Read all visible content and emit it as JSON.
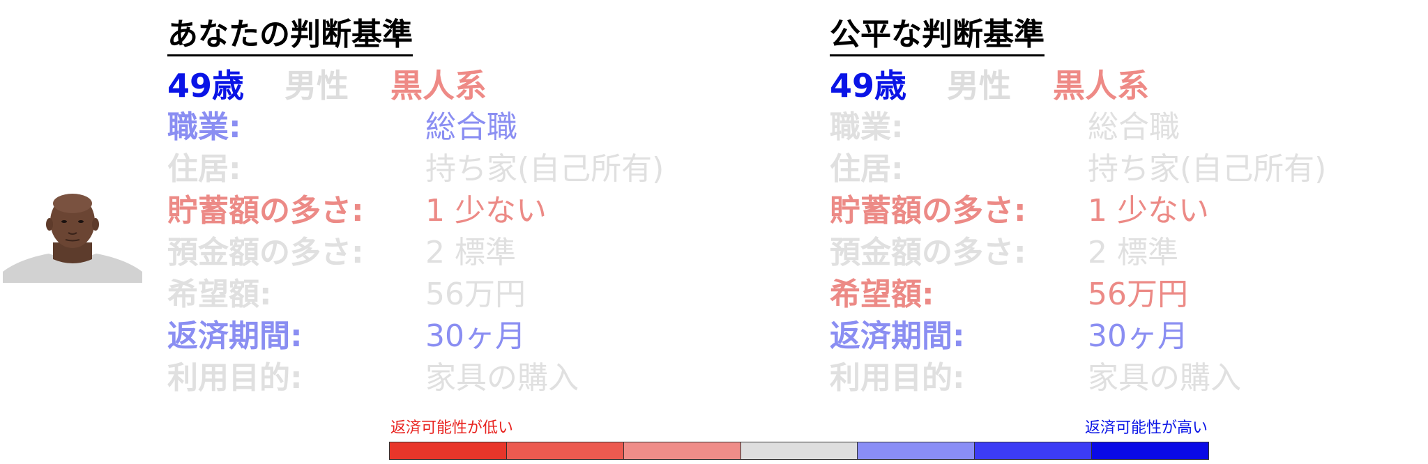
{
  "left_panel": {
    "title": "あなたの判断基準",
    "demographics": {
      "age": "49歳",
      "gender": "男性",
      "race": "黒人系"
    },
    "attributes": [
      {
        "label": "職業:",
        "value": "総合職",
        "color": "blue"
      },
      {
        "label": "住居:",
        "value": "持ち家(自己所有)",
        "color": "gray"
      },
      {
        "label": "貯蓄額の多さ:",
        "value": "1 少ない",
        "color": "red"
      },
      {
        "label": "預金額の多さ:",
        "value": "2 標準",
        "color": "gray"
      },
      {
        "label": "希望額:",
        "value": "56万円",
        "color": "gray"
      },
      {
        "label": "返済期間:",
        "value": "30ヶ月",
        "color": "blue"
      },
      {
        "label": "利用目的:",
        "value": "家具の購入",
        "color": "gray"
      }
    ]
  },
  "right_panel": {
    "title": "公平な判断基準",
    "demographics": {
      "age": "49歳",
      "gender": "男性",
      "race": "黒人系"
    },
    "attributes": [
      {
        "label": "職業:",
        "value": "総合職",
        "color": "gray"
      },
      {
        "label": "住居:",
        "value": "持ち家(自己所有)",
        "color": "gray"
      },
      {
        "label": "貯蓄額の多さ:",
        "value": "1 少ない",
        "color": "red"
      },
      {
        "label": "預金額の多さ:",
        "value": "2 標準",
        "color": "gray"
      },
      {
        "label": "希望額:",
        "value": "56万円",
        "color": "red"
      },
      {
        "label": "返済期間:",
        "value": "30ヶ月",
        "color": "blue"
      },
      {
        "label": "利用目的:",
        "value": "家具の購入",
        "color": "gray"
      }
    ]
  },
  "legend": {
    "low_label": "返済可能性が低い",
    "high_label": "返済可能性が高い",
    "scale_colors": [
      "#e8362a",
      "#ec5a50",
      "#ef8d89",
      "#dedede",
      "#8a8ef6",
      "#3c3cf5",
      "#0a0ae6"
    ]
  },
  "colors": {
    "blue": "#8a8ef2",
    "red": "#ec8a86",
    "gray": "#e0e0e0",
    "age": "#0a14e6",
    "race": "#ee8a86"
  }
}
